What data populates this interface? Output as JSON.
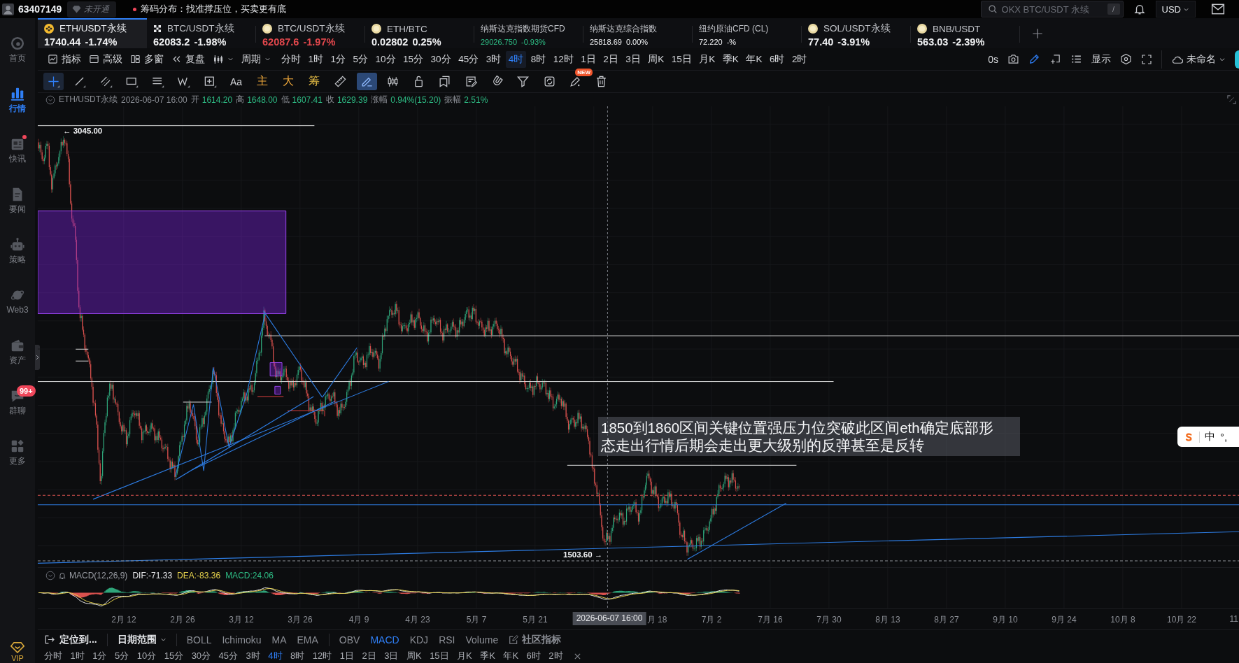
{
  "top_bar": {
    "account_id": "63407149",
    "membership": "未开通",
    "notice": "筹码分布：找准撑压位，买卖更有底",
    "search": {
      "placeholder": "OKX BTC/USDT 永续",
      "shortcut": "/"
    },
    "currency": "USD"
  },
  "sidebar": {
    "items": [
      {
        "label": "首页",
        "selected": false,
        "unread": false
      },
      {
        "label": "行情",
        "selected": true,
        "unread": false
      },
      {
        "label": "快讯",
        "selected": false,
        "unread": true
      },
      {
        "label": "要闻",
        "selected": false,
        "unread": false
      },
      {
        "label": "策略",
        "selected": false,
        "unread": false
      },
      {
        "label": "Web3",
        "selected": false,
        "unread": false
      },
      {
        "label": "资产",
        "selected": false,
        "unread": false
      },
      {
        "label": "群聊",
        "selected": false,
        "unread": false,
        "badge": "99+"
      },
      {
        "label": "更多",
        "selected": false,
        "unread": false
      }
    ],
    "vip": "VIP"
  },
  "tickers": [
    {
      "kind": "diamond",
      "name": "ETH/USDT永续",
      "price": "1740.44",
      "change": "-1.74%",
      "color": "#f2f3f5",
      "selected": true
    },
    {
      "kind": "dots",
      "name": "BTC/USDT永续",
      "price": "62083.2",
      "change": "-1.98%",
      "color": "#f2f3f5",
      "selected": false
    },
    {
      "kind": "coin",
      "name": "BTC/USDT永续",
      "price": "62087.6",
      "change": "-1.97%",
      "color": "#e5484d",
      "selected": false
    },
    {
      "kind": "coin",
      "name": "ETH/BTC",
      "price": "0.02802",
      "change": "0.25%",
      "color": "#f2f3f5",
      "selected": false
    },
    {
      "kind": "index",
      "name": "纳斯达克指数期货CFD",
      "price": "29026.750",
      "change": "-0.93%",
      "color": "#2ebd85",
      "selected": false
    },
    {
      "kind": "index",
      "name": "纳斯达克综合指数",
      "price": "25818.69",
      "change": "0.00%",
      "color": "#f2f3f5",
      "selected": false
    },
    {
      "kind": "index",
      "name": "纽约原油CFD (CL)",
      "price": "72.220",
      "change": "-%",
      "color": "#f2f3f5",
      "selected": false
    },
    {
      "kind": "coin",
      "name": "SOL/USDT永续",
      "price": "77.40",
      "change": "-3.91%",
      "color": "#f2f3f5",
      "selected": false
    },
    {
      "kind": "coin",
      "name": "BNB/USDT",
      "price": "563.03",
      "change": "-2.39%",
      "color": "#f2f3f5",
      "selected": false
    }
  ],
  "toolbar": {
    "tools": [
      "指标",
      "高级",
      "多窗",
      "复盘"
    ],
    "period_menu": "周期",
    "periods": [
      {
        "label": "分时",
        "selected": false
      },
      {
        "label": "1时",
        "selected": false
      },
      {
        "label": "1分",
        "selected": false
      },
      {
        "label": "5分",
        "selected": false
      },
      {
        "label": "10分",
        "selected": false
      },
      {
        "label": "15分",
        "selected": false
      },
      {
        "label": "30分",
        "selected": false
      },
      {
        "label": "45分",
        "selected": false
      },
      {
        "label": "3时",
        "selected": false
      },
      {
        "label": "4时",
        "selected": true
      },
      {
        "label": "8时",
        "selected": false
      },
      {
        "label": "12时",
        "selected": false
      },
      {
        "label": "1日",
        "selected": false
      },
      {
        "label": "2日",
        "selected": false
      },
      {
        "label": "3日",
        "selected": false
      },
      {
        "label": "周K",
        "selected": false
      },
      {
        "label": "15日",
        "selected": false
      },
      {
        "label": "月K",
        "selected": false
      },
      {
        "label": "季K",
        "selected": false
      },
      {
        "label": "年K",
        "selected": false
      },
      {
        "label": "6时",
        "selected": false
      },
      {
        "label": "2时",
        "selected": false
      }
    ],
    "timer": "0s",
    "edit_mode": true,
    "display": "显示",
    "layout_name": "未命名"
  },
  "drawing_toolbar": {
    "crosshair_selected": true,
    "pen_selected": true,
    "text_tools": [
      {
        "label": "Aa",
        "color": "#d4d6da"
      },
      {
        "label": "主",
        "color": "#f0a93b"
      },
      {
        "label": "大",
        "color": "#f0a93b"
      },
      {
        "label": "筹",
        "color": "#e9c046"
      }
    ],
    "new_badge": "NEW"
  },
  "ohlc_header": {
    "symbol": "ETH/USDT永续",
    "time": "2026-06-07 16:00",
    "fields": [
      {
        "label": "开",
        "value": "1614.20"
      },
      {
        "label": "高",
        "value": "1648.00"
      },
      {
        "label": "低",
        "value": "1607.41"
      },
      {
        "label": "收",
        "value": "1629.39"
      },
      {
        "label": "涨幅",
        "value": "0.94%(15.20)"
      },
      {
        "label": "振幅",
        "value": "2.51%"
      }
    ]
  },
  "chart": {
    "high_marker": "← 3045.00",
    "low_marker": "1503.60 →",
    "annotation": "1850到1860区间关键位置强压力位突破此区间eth确定底部形态走出行情后期会走出更大级别的反弹甚至是反转",
    "crosshair_time": "2026-06-07 16:00",
    "x_labels": [
      "2月 12",
      "2月 26",
      "3月 12",
      "3月 26",
      "4月 9",
      "4月 23",
      "5月 7",
      "5月 21",
      "月 18",
      "7月 2",
      "7月 16",
      "7月 30",
      "8月 13",
      "8月 27",
      "9月 10",
      "9月 24",
      "10月 8",
      "10月 22",
      "11"
    ]
  },
  "macd": {
    "title": "MACD(12,26,9)",
    "dif": "DIF:-71.33",
    "dea": "DEA:-83.36",
    "macd": "MACD:24.06"
  },
  "bottom_toolbar": {
    "locate": "定位到...",
    "date_range": "日期范围",
    "main_indicators": [
      {
        "label": "BOLL",
        "selected": false
      },
      {
        "label": "Ichimoku",
        "selected": false
      },
      {
        "label": "MA",
        "selected": false
      },
      {
        "label": "EMA",
        "selected": false
      }
    ],
    "sub_indicators": [
      {
        "label": "OBV",
        "selected": false
      },
      {
        "label": "MACD",
        "selected": true
      },
      {
        "label": "KDJ",
        "selected": false
      },
      {
        "label": "RSI",
        "selected": false
      },
      {
        "label": "Volume",
        "selected": false
      }
    ],
    "community": "社区指标"
  },
  "bottom_periods": [
    {
      "label": "分时",
      "selected": false
    },
    {
      "label": "1时",
      "selected": false
    },
    {
      "label": "1分",
      "selected": false
    },
    {
      "label": "5分",
      "selected": false
    },
    {
      "label": "10分",
      "selected": false
    },
    {
      "label": "15分",
      "selected": false
    },
    {
      "label": "30分",
      "selected": false
    },
    {
      "label": "45分",
      "selected": false
    },
    {
      "label": "3时",
      "selected": false
    },
    {
      "label": "4时",
      "selected": true
    },
    {
      "label": "8时",
      "selected": false
    },
    {
      "label": "12时",
      "selected": false
    },
    {
      "label": "1日",
      "selected": false
    },
    {
      "label": "2日",
      "selected": false
    },
    {
      "label": "3日",
      "selected": false
    },
    {
      "label": "周K",
      "selected": false
    },
    {
      "label": "15日",
      "selected": false
    },
    {
      "label": "月K",
      "selected": false
    },
    {
      "label": "季K",
      "selected": false
    },
    {
      "label": "年K",
      "selected": false
    },
    {
      "label": "6时",
      "selected": false
    },
    {
      "label": "2时",
      "selected": false
    }
  ],
  "ime": {
    "mode": "中",
    "punctuation": "°,"
  }
}
